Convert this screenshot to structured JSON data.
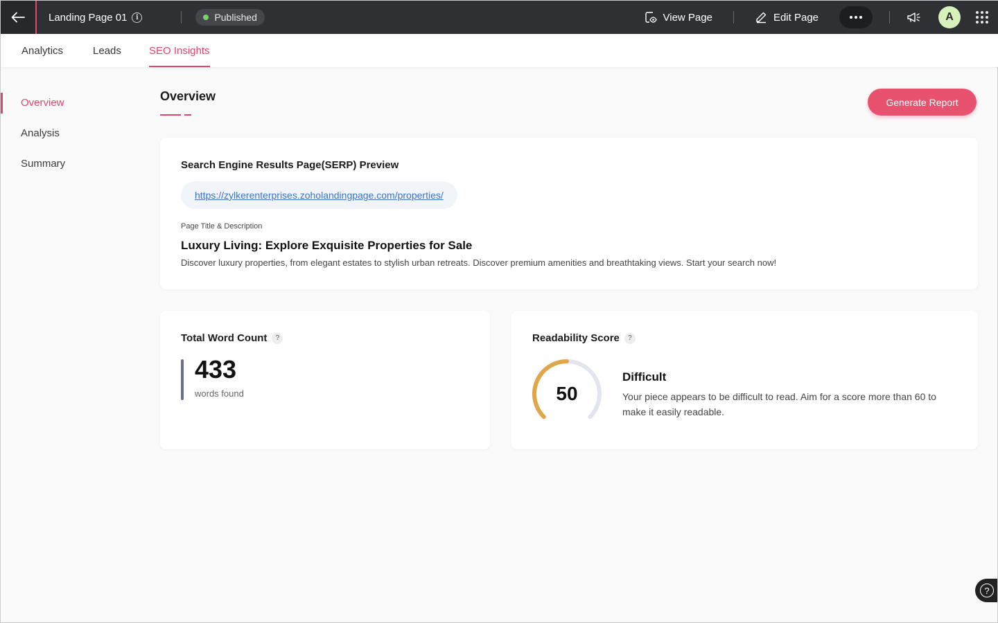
{
  "topbar": {
    "page_name": "Landing Page 01",
    "status": "Published",
    "view_page": "View Page",
    "edit_page": "Edit Page",
    "avatar_initial": "A",
    "status_color": "#7ecf6b",
    "icons": [
      "back-arrow-icon",
      "info-icon",
      "view-page-icon",
      "edit-pencil-icon",
      "more-dots-icon",
      "announcement-megaphone-icon",
      "apps-grid-icon"
    ]
  },
  "tabs": [
    {
      "label": "Analytics",
      "active": false
    },
    {
      "label": "Leads",
      "active": false
    },
    {
      "label": "SEO Insights",
      "active": true
    }
  ],
  "sidenav": {
    "items": [
      {
        "label": "Overview",
        "active": true
      },
      {
        "label": "Analysis",
        "active": false
      },
      {
        "label": "Summary",
        "active": false
      }
    ]
  },
  "main": {
    "title": "Overview",
    "generate_button": "Generate Report"
  },
  "serp": {
    "heading": "Search Engine Results Page(SERP) Preview",
    "url": "https://zylkerenterprises.zoholandingpage.com/properties/",
    "label": "Page Title & Description",
    "page_title": "Luxury Living: Explore Exquisite Properties for Sale",
    "description": "Discover luxury properties, from elegant estates to stylish urban retreats. Discover premium amenities and breathtaking views. Start your search now!"
  },
  "word_count": {
    "heading": "Total Word Count",
    "help": "?",
    "value": "433",
    "caption": "words found"
  },
  "readability": {
    "heading": "Readability Score",
    "help": "?",
    "score": "50",
    "score_fraction": 0.5,
    "level": "Difficult",
    "text": "Your piece appears to be difficult to read. Aim for a score more than 60 to make it easily readable.",
    "gauge_color": "#e0a64a",
    "track_color": "#e3e5ee"
  },
  "colors": {
    "accent": "#e0466a",
    "topbar": "#2f3034",
    "link": "#3c73c7"
  },
  "float_help": "?"
}
